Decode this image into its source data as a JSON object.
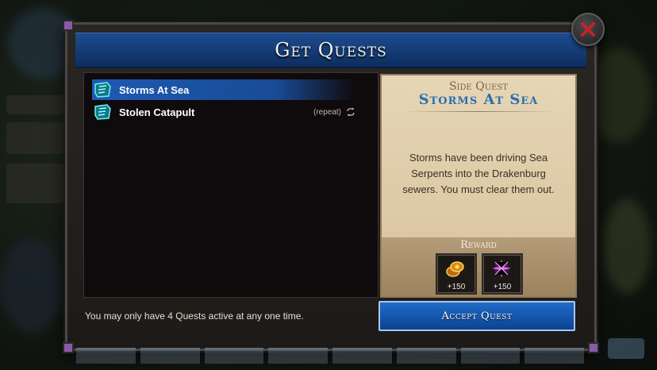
{
  "window": {
    "title": "Get Quests",
    "close_icon": "close-x-icon"
  },
  "quests": [
    {
      "label": "Storms At Sea",
      "icon": "quest-scroll-icon",
      "selected": true,
      "repeat": ""
    },
    {
      "label": "Stolen Catapult",
      "icon": "quest-scroll-icon",
      "selected": false,
      "repeat": "(repeat)"
    }
  ],
  "detail": {
    "subtitle": "Side Quest",
    "title": "Storms At Sea",
    "description": "Storms have been driving Sea Serpents into the Drakenburg sewers. You must clear them out.",
    "reward_label": "Reward",
    "rewards": [
      {
        "icon": "gold-coins-icon",
        "amount": "+150"
      },
      {
        "icon": "purple-star-icon",
        "amount": "+150"
      }
    ]
  },
  "footer": {
    "limit_note": "You may only have 4 Quests active at any one time.",
    "accept_label": "Accept Quest"
  },
  "colors": {
    "header_blue": "#1d4c8f",
    "selected_row": "#1e5ab2",
    "parchment": "#e6d6b6",
    "title_blue": "#2b6fb0",
    "close_red": "#c0242a"
  }
}
